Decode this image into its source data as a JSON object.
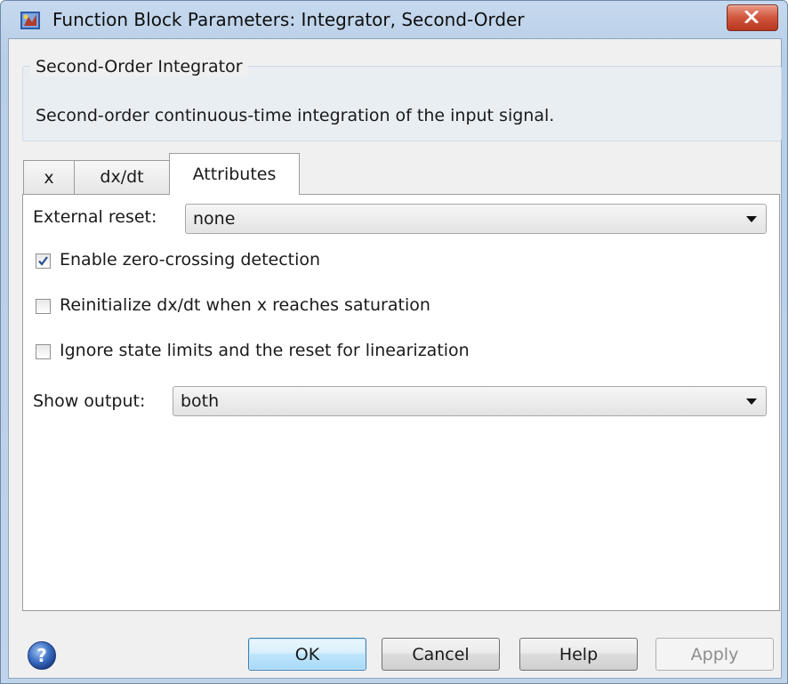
{
  "window": {
    "title": "Function Block Parameters: Integrator, Second-Order",
    "app_icon": "simulink-block-icon",
    "close_icon": "close-x-icon"
  },
  "group": {
    "title": "Second-Order Integrator",
    "description": "Second-order continuous-time integration of the input signal."
  },
  "tabs": [
    {
      "label": "x",
      "active": false
    },
    {
      "label": "dx/dt",
      "active": false
    },
    {
      "label": "Attributes",
      "active": true
    }
  ],
  "attributes": {
    "external_reset_label": "External reset:",
    "external_reset_value": "none",
    "checkboxes": [
      {
        "label": "Enable zero-crossing detection",
        "checked": true
      },
      {
        "label": "Reinitialize dx/dt when x reaches saturation",
        "checked": false
      },
      {
        "label": "Ignore state limits and the reset for linearization",
        "checked": false
      }
    ],
    "show_output_label": "Show output:",
    "show_output_value": "both"
  },
  "buttons": {
    "help_icon": "help-question-icon",
    "ok": "OK",
    "cancel": "Cancel",
    "help": "Help",
    "apply": "Apply",
    "apply_enabled": false
  },
  "colors": {
    "frame": "#bfd3ea",
    "close_button": "#c9452c",
    "ok_button": "#bee6fd"
  }
}
